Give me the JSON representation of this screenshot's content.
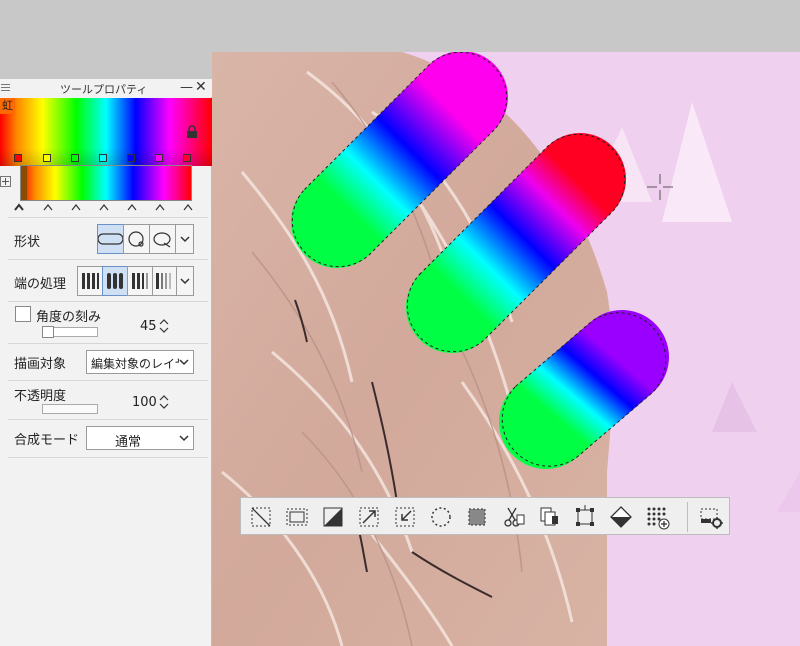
{
  "panel": {
    "title": "ツールプロパティ",
    "gradient_name": "虹",
    "stop_colors": [
      "#ff0000",
      "#ffff00",
      "#00ff00",
      "#00ffff",
      "#0000ff",
      "#ff00ff",
      "#ff0033"
    ],
    "shape_label": "形状",
    "cap_label": "端の処理",
    "angle_label": "角度の刻み",
    "angle_value": "45",
    "angle_checked": false,
    "target_label": "描画対象",
    "target_value": "編集対象のレイヤー",
    "opacity_label": "不透明度",
    "opacity_value": "100",
    "opacity_level": 1.0,
    "blend_label": "合成モード",
    "blend_value": "通常"
  },
  "colors": {
    "canvas_bg": "#efd0ef",
    "panel_bg": "#f2f2f2",
    "active_seg": "#cfe0f5"
  },
  "toolbar": {
    "buttons": [
      "deselect-icon",
      "invert-selection-icon",
      "clear-outside-icon",
      "scale-rotate-icon",
      "shrink-selection-icon",
      "expand-selection-icon",
      "selection-layer-icon",
      "cut-paste-icon",
      "copy-paste-icon",
      "transform-icon",
      "fill-icon",
      "add-tone-icon",
      "toolbar-settings-icon"
    ]
  }
}
